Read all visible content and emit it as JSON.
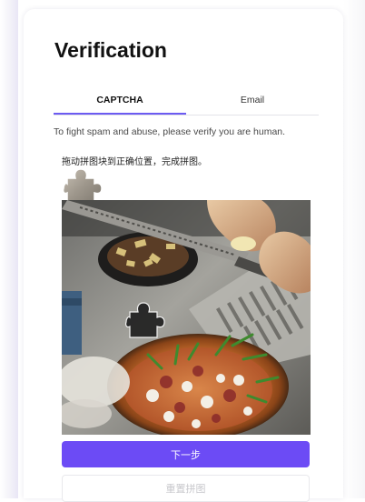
{
  "title": "Verification",
  "tabs": [
    {
      "label": "CAPTCHA",
      "active": true
    },
    {
      "label": "Email",
      "active": false
    }
  ],
  "info_text": "To fight spam and abuse, please verify you are human.",
  "captcha": {
    "instruction": "拖动拼图块到正确位置，完成拼图。",
    "primary_button": "下一步",
    "secondary_button": "重置拼图"
  },
  "colors": {
    "accent": "#6c4bf5",
    "tab_underline": "#6c5bf2"
  }
}
